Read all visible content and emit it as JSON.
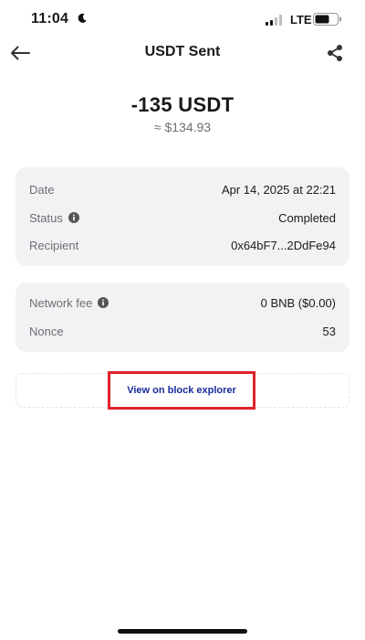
{
  "status_bar": {
    "time": "11:04",
    "network": "LTE",
    "icons": [
      "moon-icon",
      "signal-icon",
      "battery-icon"
    ]
  },
  "nav": {
    "title": "USDT Sent",
    "back_icon": "arrow-left-icon",
    "share_icon": "share-icon"
  },
  "amount": {
    "value": "-135 USDT",
    "fiat": "≈ $134.93"
  },
  "details": [
    {
      "label": "Date",
      "value": "Apr 14, 2025 at 22:21",
      "info": false
    },
    {
      "label": "Status",
      "value": "Completed",
      "info": true
    },
    {
      "label": "Recipient",
      "value": "0x64bF7...2DdFe94",
      "info": false
    }
  ],
  "fees": [
    {
      "label": "Network fee",
      "value": "0 BNB ($0.00)",
      "info": true
    },
    {
      "label": "Nonce",
      "value": "53",
      "info": false
    }
  ],
  "explorer": {
    "label": "View on block explorer"
  },
  "colors": {
    "accent_link": "#1a2c9c",
    "highlight": "#e0222a",
    "card_bg": "#f2f2f4"
  }
}
